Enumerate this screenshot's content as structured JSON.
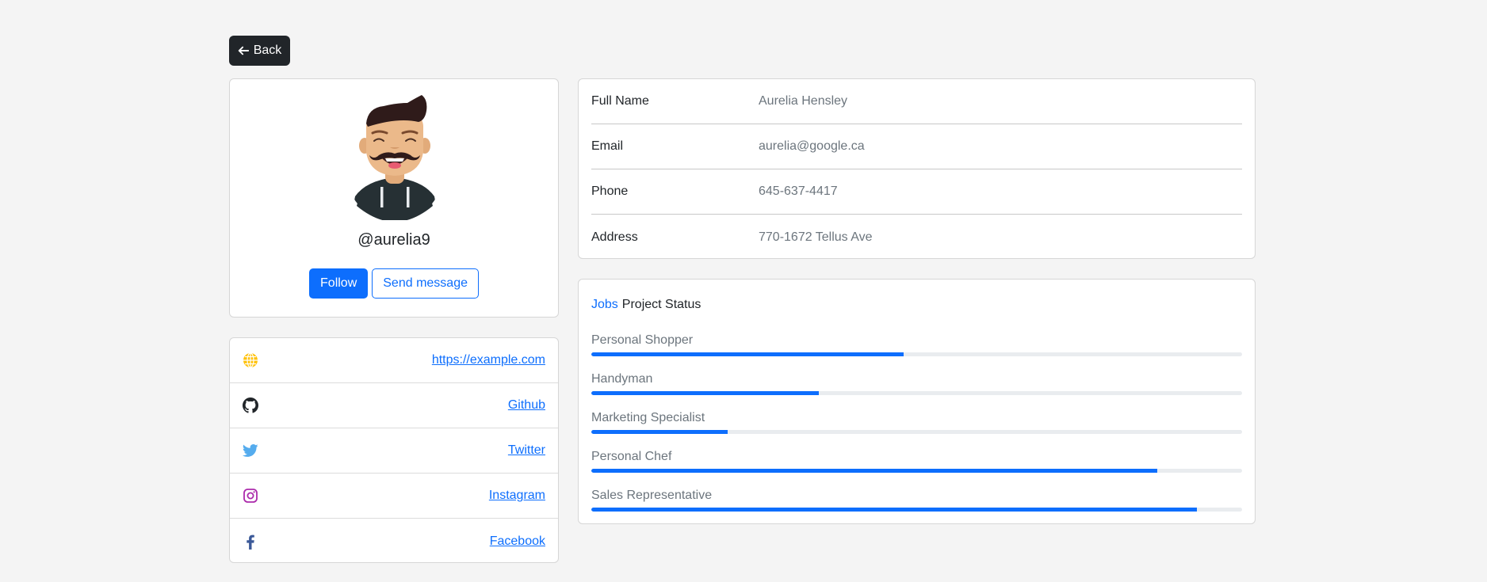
{
  "nav": {
    "back_label": "Back",
    "back_icon": "arrow-left-icon"
  },
  "profile": {
    "avatar_icon": "avatar-illustration",
    "username": "@aurelia9",
    "follow_label": "Follow",
    "message_label": "Send message"
  },
  "social": [
    {
      "icon": "globe-icon",
      "label": "https://example.com",
      "color": "#ffc107"
    },
    {
      "icon": "github-icon",
      "label": "Github",
      "color": "#212529"
    },
    {
      "icon": "twitter-icon",
      "label": "Twitter",
      "color": "#55acee"
    },
    {
      "icon": "instagram-icon",
      "label": "Instagram",
      "color": "#ac2bac"
    },
    {
      "icon": "facebook-icon",
      "label": "Facebook",
      "color": "#3b5998"
    }
  ],
  "details": [
    {
      "label": "Full Name",
      "value": "Aurelia Hensley"
    },
    {
      "label": "Email",
      "value": "aurelia@google.ca"
    },
    {
      "label": "Phone",
      "value": "645-637-4417"
    },
    {
      "label": "Address",
      "value": "770-1672 Tellus Ave"
    }
  ],
  "jobs": {
    "title_accent": "Jobs",
    "title": "Project Status",
    "items": [
      {
        "label": "Personal Shopper",
        "progress": 48
      },
      {
        "label": "Handyman",
        "progress": 35
      },
      {
        "label": "Marketing Specialist",
        "progress": 21
      },
      {
        "label": "Personal Chef",
        "progress": 87
      },
      {
        "label": "Sales Representative",
        "progress": 93
      }
    ]
  },
  "colors": {
    "primary": "#0d6efd",
    "dark": "#212529",
    "muted": "#6c757d",
    "track": "#e9ecef"
  }
}
